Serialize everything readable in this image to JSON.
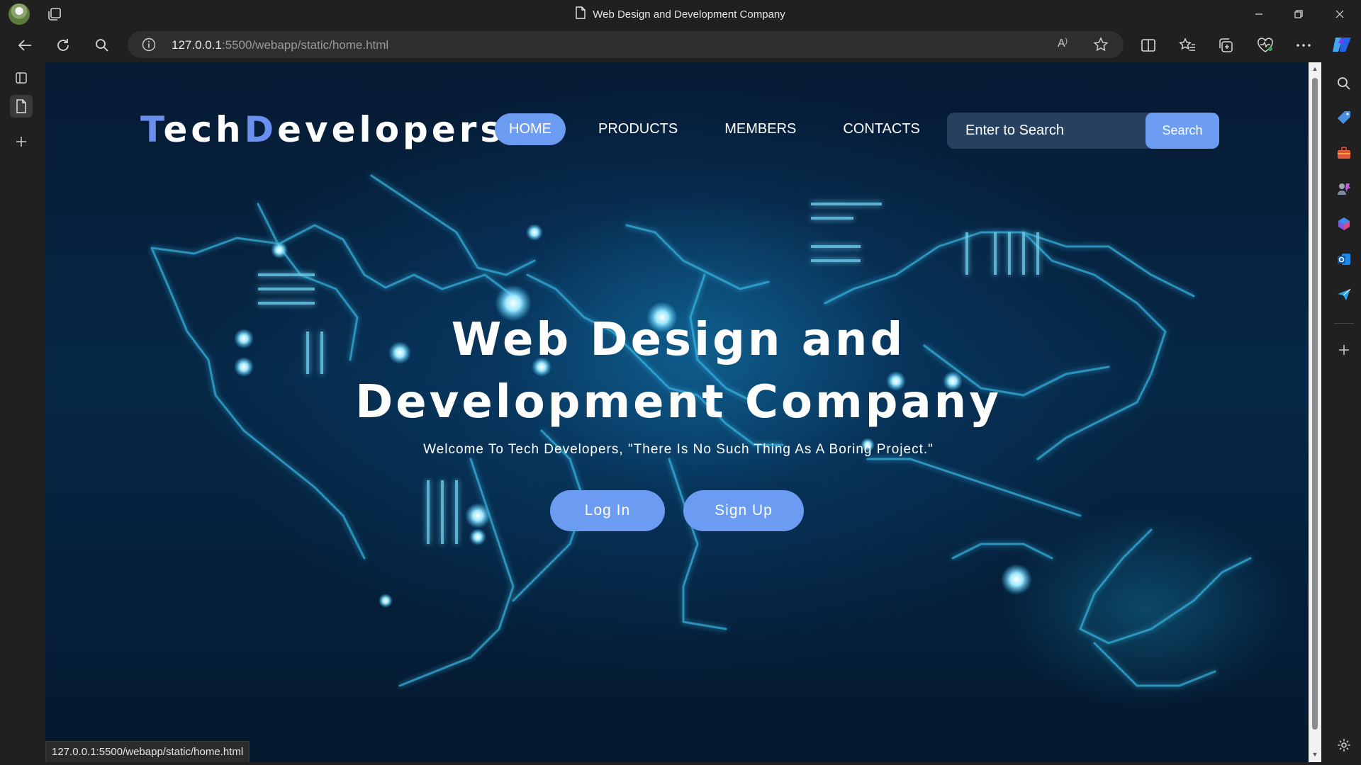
{
  "browser": {
    "tab_title": "Web Design and Development Company",
    "url_host": "127.0.0.1",
    "url_path": ":5500/webapp/static/home.html",
    "read_aloud_label": "A",
    "status_url": "127.0.0.1:5500/webapp/static/home.html"
  },
  "site": {
    "logo_first_letter": "T",
    "logo_first_rest": "ech",
    "logo_second_letter": "D",
    "logo_second_rest": "evelopers",
    "nav": {
      "home": "HOME",
      "products": "PRODUCTS",
      "members": "MEMBERS",
      "contacts": "CONTACTS"
    },
    "search": {
      "placeholder": "Enter to Search",
      "button": "Search"
    },
    "hero": {
      "headline_line1": "Web Design and",
      "headline_line2": "Development Company",
      "tagline": "Welcome To Tech Developers, \"There Is No Such Thing As A Boring Project.\"",
      "login": "Log In",
      "signup": "Sign Up"
    }
  },
  "colors": {
    "accent": "#6b9cf2",
    "logo_accent": "#6b8fef",
    "hero_dark": "#041226",
    "browser_chrome": "#202020"
  }
}
